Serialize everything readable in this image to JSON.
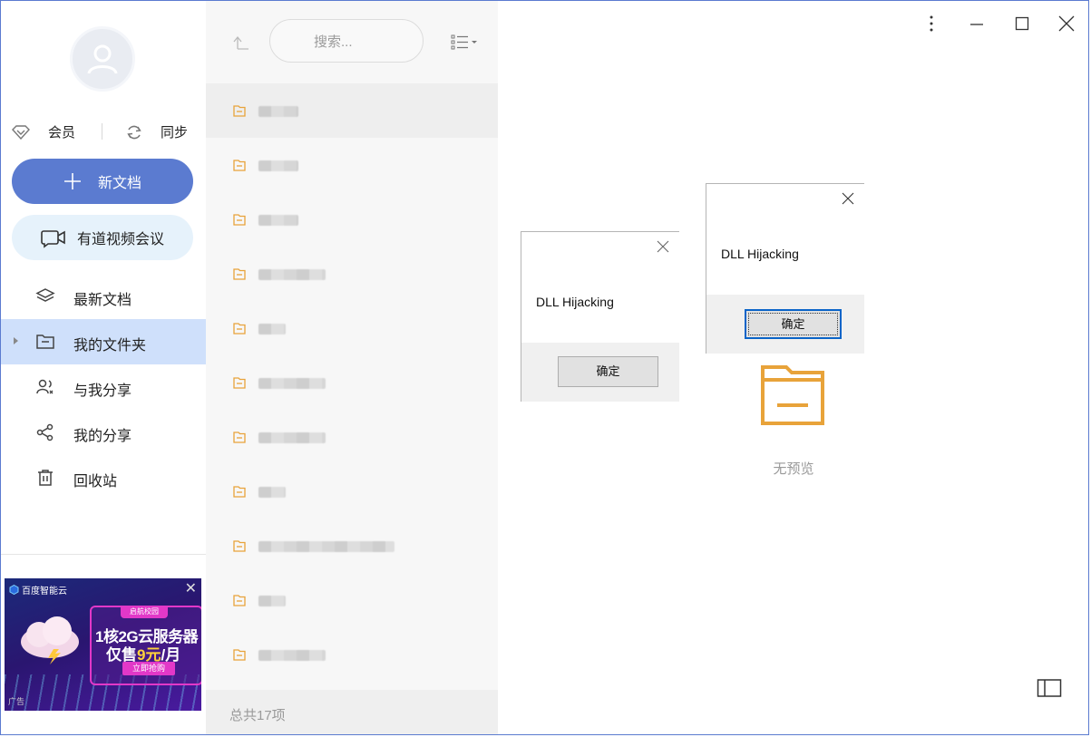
{
  "sidebar": {
    "vip_label": "会员",
    "sync_label": "同步",
    "new_doc_label": "新文档",
    "meeting_label": "有道视频会议",
    "nav": [
      {
        "label": "最新文档",
        "icon": "layers-icon"
      },
      {
        "label": "我的文件夹",
        "icon": "folder-icon",
        "active": true
      },
      {
        "label": "与我分享",
        "icon": "shared-with-me-icon"
      },
      {
        "label": "我的分享",
        "icon": "share-icon"
      },
      {
        "label": "回收站",
        "icon": "trash-icon"
      }
    ]
  },
  "ad": {
    "brand": "百度智能云",
    "tag": "启航校园",
    "line1": "1核2G云服务器",
    "line2_prefix": "仅售",
    "line2_price": "9元",
    "line2_suffix": "/月",
    "cta": "立即抢购",
    "ad_label": "广告"
  },
  "file_list": {
    "search_placeholder": "搜索...",
    "total_text": "总共17项",
    "rows": [
      {
        "type": "folder",
        "selected": true
      },
      {
        "type": "folder"
      },
      {
        "type": "folder"
      },
      {
        "type": "folder"
      },
      {
        "type": "folder"
      },
      {
        "type": "folder"
      },
      {
        "type": "folder"
      },
      {
        "type": "folder"
      },
      {
        "type": "folder"
      },
      {
        "type": "folder"
      },
      {
        "type": "folder"
      }
    ]
  },
  "preview": {
    "empty_text": "无预览"
  },
  "dialogs": [
    {
      "message": "DLL Hijacking",
      "ok_label": "确定"
    },
    {
      "message": "DLL Hijacking",
      "ok_label": "确定"
    }
  ],
  "colors": {
    "accent": "#5b7bd0",
    "active_nav": "#cfe0fb",
    "meeting_bg": "#e6f2fb",
    "folder": "#e8a33a"
  }
}
